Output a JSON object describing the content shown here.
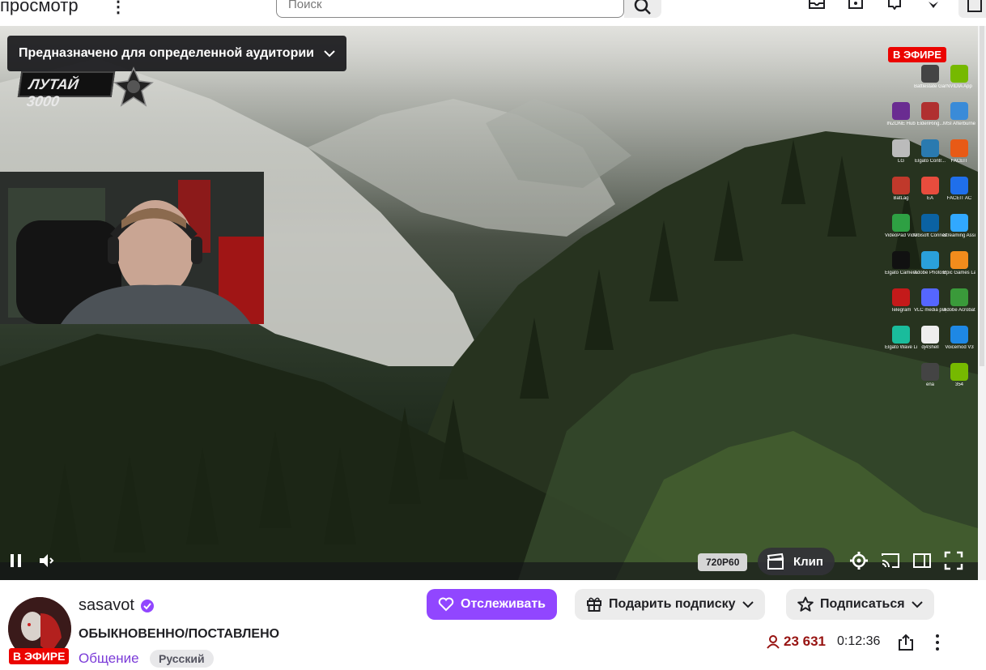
{
  "topbar": {
    "title_fragment": "просмотр",
    "search_placeholder": "Поиск"
  },
  "player": {
    "audience_label": "Предназначено для определенной аудитории",
    "logo_text": "ЛУТАЙ 3000",
    "live_overlay": "В ЭФИРЕ",
    "quality": "720P60",
    "clip_label": "Клип"
  },
  "desktop_icons": [
    {
      "label": "Battlestate Games L..."
    },
    {
      "label": "NVIDIA App"
    },
    {
      "label": "INZONE Hub"
    },
    {
      "label": "EldenRing..."
    },
    {
      "label": "MSI Afterburner"
    },
    {
      "label": "LG"
    },
    {
      "label": "Elgato Contr..."
    },
    {
      "label": "FACEIT"
    },
    {
      "label": "BatLag"
    },
    {
      "label": "EA"
    },
    {
      "label": "FACEIT AC"
    },
    {
      "label": "VideoPad Video Editor"
    },
    {
      "label": "Ubisoft Connect"
    },
    {
      "label": "Streaming Assistant"
    },
    {
      "label": "Elgato Camera Hub"
    },
    {
      "label": "Adobe Photosh..."
    },
    {
      "label": "Epic Games Launcher"
    },
    {
      "label": "Telegram"
    },
    {
      "label": "VLC media player"
    },
    {
      "label": "Adobe Acrobat"
    },
    {
      "label": "Elgato Wave Link"
    },
    {
      "label": "dj4Shell"
    },
    {
      "label": "Voicemod V3"
    },
    {
      "label": "ena"
    },
    {
      "label": "354"
    }
  ],
  "channel": {
    "name": "sasavot",
    "live_badge": "В ЭФИРЕ",
    "stream_title": "ОБЫКНОВЕННО/ПОСТАВЛЕНО",
    "category": "Общение",
    "tag": "Русский",
    "viewers": "23 631",
    "uptime": "0:12:36"
  },
  "actions": {
    "follow": "Отслеживать",
    "gift": "Подарить подписку",
    "subscribe": "Подписаться"
  },
  "colors": {
    "accent": "#9146ff",
    "live": "#eb0400",
    "viewers": "#971311"
  }
}
